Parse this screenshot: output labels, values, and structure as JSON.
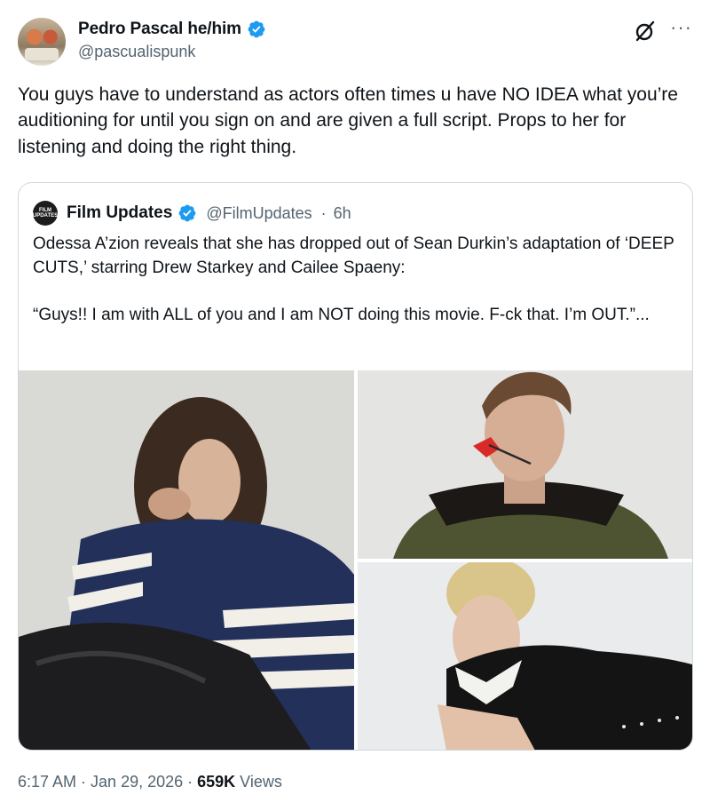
{
  "author": {
    "display_name": "Pedro Pascal he/him",
    "handle": "@pascualispunk",
    "verified_color": "#1d9bf0"
  },
  "header_icons": {
    "grok": "grok-icon",
    "more": "more-icon",
    "more_glyph": "···"
  },
  "tweet": {
    "text": "You guys have to understand as actors often times u have NO IDEA what you’re auditioning for until you sign on and are given a full script. Props to her for listening and doing the right thing."
  },
  "quoted": {
    "avatar_text": "FILM UPDATES",
    "display_name": "Film Updates",
    "handle": "@FilmUpdates",
    "separator": "·",
    "age": "6h",
    "text": "Odessa A’zion reveals that she has dropped out of Sean Durkin’s adaptation of ‘DEEP CUTS,’ starring Drew Starkey and Cailee Spaeny:\n\n“Guys!! I am with ALL of you and I am NOT doing this movie. F-ck that. I’m OUT.”...",
    "media": [
      {
        "name": "photo-odessa-azion"
      },
      {
        "name": "photo-drew-starkey"
      },
      {
        "name": "photo-cailee-spaeny"
      }
    ]
  },
  "footer": {
    "time": "6:17 AM",
    "sep1": " · ",
    "date": "Jan 29, 2026",
    "sep2": " · ",
    "views_count": "659K",
    "views_label": " Views"
  },
  "colors": {
    "accent": "#1d9bf0",
    "secondary_text": "#536471",
    "border": "#cfd9de"
  }
}
